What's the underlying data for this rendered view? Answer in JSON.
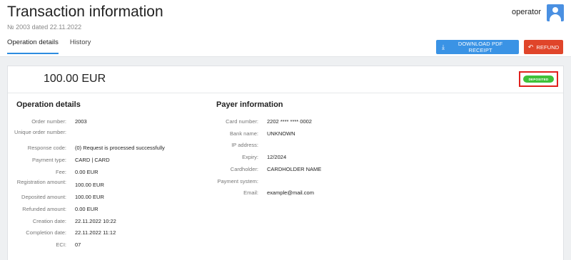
{
  "header": {
    "title": "Transaction information",
    "subtitle": "№ 2003 dated 22.11.2022",
    "username": "operator",
    "avatar_icon": "user-icon"
  },
  "tabs": [
    {
      "label": "Operation details",
      "active": true
    },
    {
      "label": "History",
      "active": false
    }
  ],
  "actions": {
    "download_label": "DOWNLOAD PDF RECEIPT",
    "download_icon": "download-icon",
    "refund_label": "REFUND",
    "refund_icon": "undo-icon"
  },
  "transaction": {
    "amount": "100.00 EUR",
    "status": "DEPOSITED"
  },
  "operation_details": {
    "title": "Operation details",
    "rows": [
      {
        "label": "Order number:",
        "value": "2003"
      },
      {
        "label": "Unique order number:",
        "value": ""
      },
      {
        "label": "Response code:",
        "value": "(0) Request is processed successfully"
      },
      {
        "label": "Payment type:",
        "value": "CARD | CARD"
      },
      {
        "label": "Fee:",
        "value": "0.00 EUR"
      },
      {
        "label": "Registration amount:",
        "value": "100.00 EUR"
      },
      {
        "label": "Deposited amount:",
        "value": "100.00 EUR"
      },
      {
        "label": "Refunded amount:",
        "value": "0.00 EUR"
      },
      {
        "label": "Creation date:",
        "value": "22.11.2022 10:22"
      },
      {
        "label": "Completion date:",
        "value": "22.11.2022 11:12"
      },
      {
        "label": "ECI:",
        "value": "07"
      }
    ]
  },
  "payer_information": {
    "title": "Payer information",
    "rows": [
      {
        "label": "Card number:",
        "value": "2202 **** **** 0002"
      },
      {
        "label": "Bank name:",
        "value": "UNKNOWN"
      },
      {
        "label": "IP address:",
        "value": ""
      },
      {
        "label": "Expiry:",
        "value": "12/2024"
      },
      {
        "label": "Cardholder:",
        "value": "CARDHOLDER NAME"
      },
      {
        "label": "Payment system:",
        "value": ""
      },
      {
        "label": "Email:",
        "value": "example@mail.com"
      }
    ]
  },
  "colors": {
    "primary": "#3a93e5",
    "danger": "#e0452a",
    "success": "#3fc13a",
    "highlight": "#e0201d"
  }
}
